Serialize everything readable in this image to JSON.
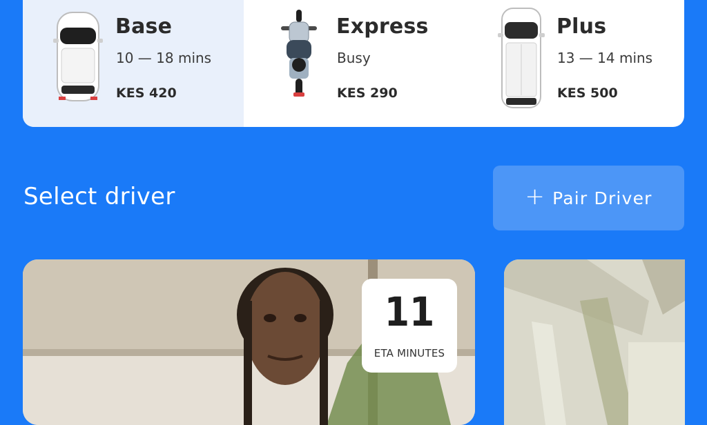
{
  "ride_options": [
    {
      "name": "Base",
      "eta": "10 — 18 mins",
      "price": "KES 420",
      "icon": "car-hatchback-icon"
    },
    {
      "name": "Express",
      "eta": "Busy",
      "price": "KES 290",
      "icon": "motorbike-icon"
    },
    {
      "name": "Plus",
      "eta": "13 — 14 mins",
      "price": "KES 500",
      "icon": "car-wagon-icon"
    }
  ],
  "driver_section": {
    "title": "Select driver",
    "pair_button_label": "Pair Driver"
  },
  "drivers": [
    {
      "eta_value": "11",
      "eta_label": "ETA MINUTES"
    }
  ],
  "colors": {
    "background": "#1a7af8",
    "selected_option": "#e9f0fb",
    "pair_button": "#4c96f7"
  }
}
